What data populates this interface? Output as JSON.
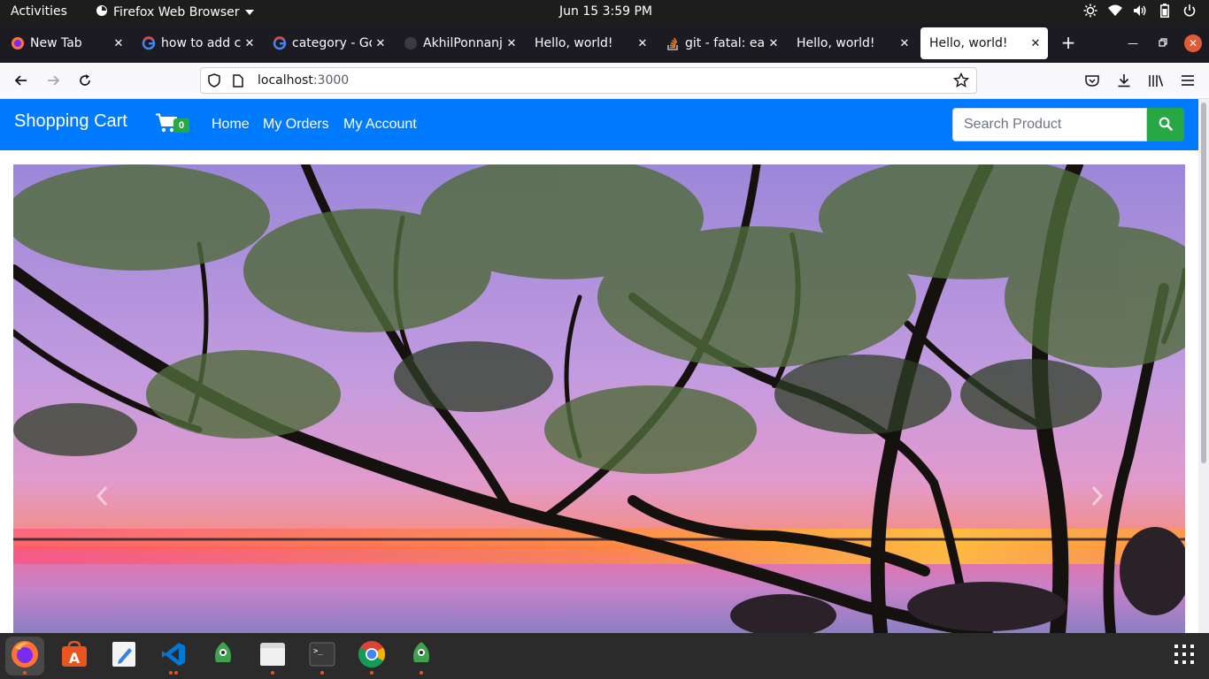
{
  "topbar": {
    "activities": "Activities",
    "app_menu": "Firefox Web Browser",
    "clock": "Jun 15   3:59 PM",
    "status_icons": [
      "brightness-icon",
      "wifi-icon",
      "volume-icon",
      "battery-icon",
      "power-icon"
    ]
  },
  "browser": {
    "tabs": [
      {
        "title": "New Tab",
        "favicon": "firefox-icon",
        "active": false
      },
      {
        "title": "how to add ca",
        "favicon": "google-icon",
        "active": false
      },
      {
        "title": "category - Go",
        "favicon": "google-icon",
        "active": false
      },
      {
        "title": "AkhilPonnanj",
        "favicon": "github-icon",
        "active": false
      },
      {
        "title": "Hello, world!",
        "favicon": "",
        "active": false
      },
      {
        "title": "git - fatal: earl",
        "favicon": "stackoverflow-icon",
        "active": false
      },
      {
        "title": "Hello, world!",
        "favicon": "",
        "active": false
      },
      {
        "title": "Hello, world!",
        "favicon": "",
        "active": true
      }
    ],
    "url_host": "localhost",
    "url_port": ":3000"
  },
  "app": {
    "brand": "Shopping Cart",
    "cart_count": "0",
    "nav_links": [
      "Home",
      "My Orders",
      "My Account"
    ],
    "search_placeholder": "Search Product",
    "colors": {
      "navbar": "#007bff",
      "search_button": "#28a745",
      "badge": "#28a745"
    }
  },
  "carousel": {
    "image": "sunset-lake-trees-photo",
    "prev_icon": "chevron-left-icon",
    "next_icon": "chevron-right-icon"
  },
  "dock": {
    "apps": [
      "firefox-icon",
      "software-store-icon",
      "text-editor-icon",
      "vscode-icon",
      "robo3t-icon",
      "files-icon",
      "terminal-icon",
      "chrome-icon",
      "robo3t-icon"
    ],
    "show_apps_icon": "grid-icon"
  }
}
